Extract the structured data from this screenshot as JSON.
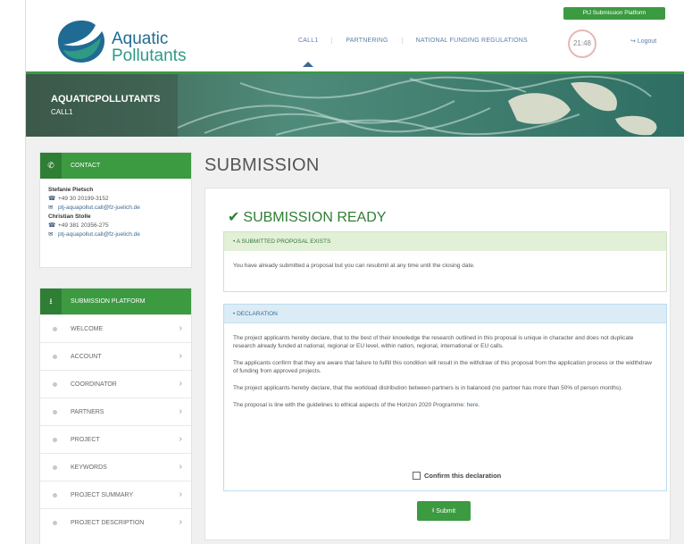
{
  "header": {
    "logo_line1": "Aquatic",
    "logo_line2": "Pollutants",
    "platform_tag": "PtJ Submission Platform",
    "nav": [
      "CALL1",
      "PARTNERING",
      "NATIONAL FUNDING REGULATIONS"
    ],
    "timer": "21:48",
    "logout": "Logout"
  },
  "banner": {
    "title": "AQUATICPOLLUTANTS",
    "subtitle": "CALL1"
  },
  "contact": {
    "heading": "CONTACT",
    "people": [
      {
        "name": "Stefanie Pietsch",
        "phone": "+49 30 20199-3152",
        "email": "ptj-aquapollut.call@fz-juelich.de"
      },
      {
        "name": "Christian Stolle",
        "phone": "+49 381 20356-275",
        "email": "ptj-aquapollut.call@fz-juelich.de"
      }
    ]
  },
  "submission_menu": {
    "heading": "SUBMISSION PLATFORM",
    "items": [
      "WELCOME",
      "ACCOUNT",
      "COORDINATOR",
      "PARTNERS",
      "PROJECT",
      "KEYWORDS",
      "PROJECT SUMMARY",
      "PROJECT DESCRIPTION"
    ]
  },
  "main": {
    "page_title": "SUBMISSION",
    "ready_label": "SUBMISSION READY",
    "submitted_box": {
      "heading": "A SUBMITTED PROPOSAL EXISTS",
      "text": "You have already submitted a proposal but you can resubmit at any time until the closing date."
    },
    "declaration": {
      "heading": "DECLARATION",
      "p1": "The project applicants hereby declare, that to the best of their knowledge the research outlined in this proposal is unique in character and does not duplicate research already funded at national, regional or EU level, within nation, regional, international or EU calls.",
      "p2": "The applicants confirm that they are aware that failure to fulfill this condition will result in the withdraw of this proposal from the application process or the widthdraw of funding from approved projects.",
      "p3": "The project applicants hereby declare, that the workload distribution between partners is in balanced (no partner has more than 50% of person months).",
      "p4_prefix": "The proposal is line with the guidelines to ethical aspects of the Horizon 2020 Programme:",
      "p4_link": "here.",
      "confirm_label": "Confirm this declaration"
    },
    "submit_label": "Submit"
  },
  "colors": {
    "accent_green": "#3c9a41",
    "link_blue": "#3a6a93",
    "success_bg": "#e2f0d8",
    "info_bg": "#dcecf7"
  }
}
